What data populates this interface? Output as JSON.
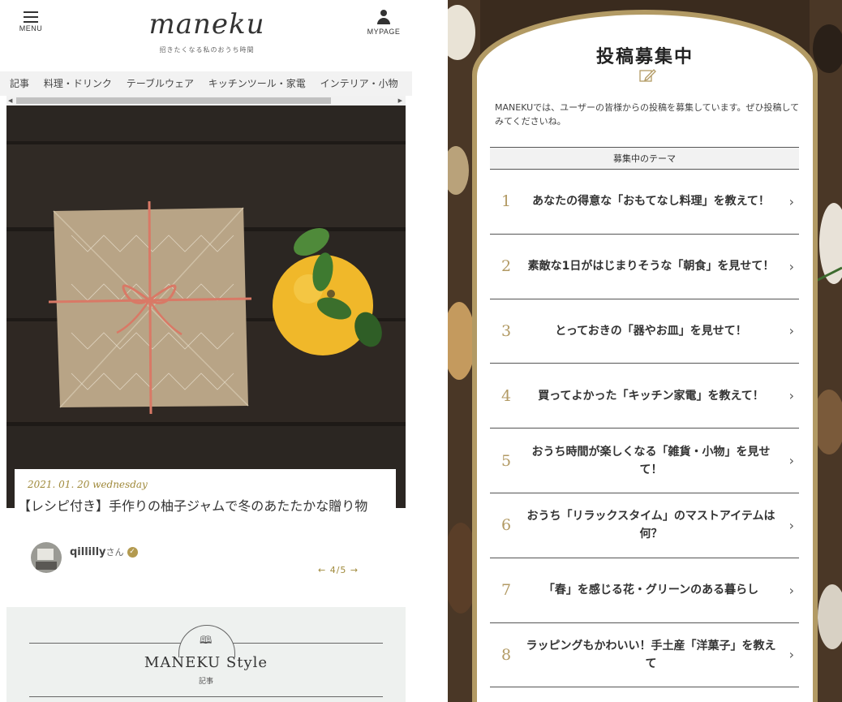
{
  "header": {
    "menu_label": "MENU",
    "logo_text": "maneku",
    "tagline": "招きたくなる私のおうち時間",
    "mypage_label": "MYPAGE"
  },
  "nav": {
    "items": [
      "記事",
      "料理・ドリンク",
      "テーブルウェア",
      "キッチンツール・家電",
      "インテリア・小物"
    ],
    "scroll_left": "◀",
    "scroll_right": "▶"
  },
  "article": {
    "date": "2021. 01. 20  wednesday",
    "title": "【レシピ付き】手作りの柚子ジャムで冬のあたたかな贈り物",
    "author": "qillilly",
    "author_suffix": "さん",
    "pager": "← 4/5 →"
  },
  "style_section": {
    "title": "MANEKU Style",
    "subtitle": "記事"
  },
  "submission": {
    "title": "投稿募集中",
    "intro": "MANEKUでは、ユーザーの皆様からの投稿を募集しています。ぜひ投稿してみてくださいね。",
    "themes_heading": "募集中のテーマ",
    "themes": [
      {
        "num": "1",
        "text": "あなたの得意な「おもてなし料理」を教えて！"
      },
      {
        "num": "2",
        "text": "素敵な1日がはじまりそうな「朝食」を見せて！"
      },
      {
        "num": "3",
        "text": "とっておきの「器やお皿」を見せて！"
      },
      {
        "num": "4",
        "text": "買ってよかった「キッチン家電」を教えて！"
      },
      {
        "num": "5",
        "text": "おうち時間が楽しくなる「雑貨・小物」を見せて！"
      },
      {
        "num": "6",
        "text": "おうち「リラックスタイム」のマストアイテムは何？"
      },
      {
        "num": "7",
        "text": "「春」を感じる花・グリーンのある暮らし"
      },
      {
        "num": "8",
        "text": "ラッピングもかわいい！手土産「洋菓子」を教えて"
      }
    ]
  },
  "colors": {
    "gold": "#b29a64",
    "date_gold": "#a08a3c",
    "hero_wood": "#2b2622",
    "style_bg": "#eef1ef"
  }
}
